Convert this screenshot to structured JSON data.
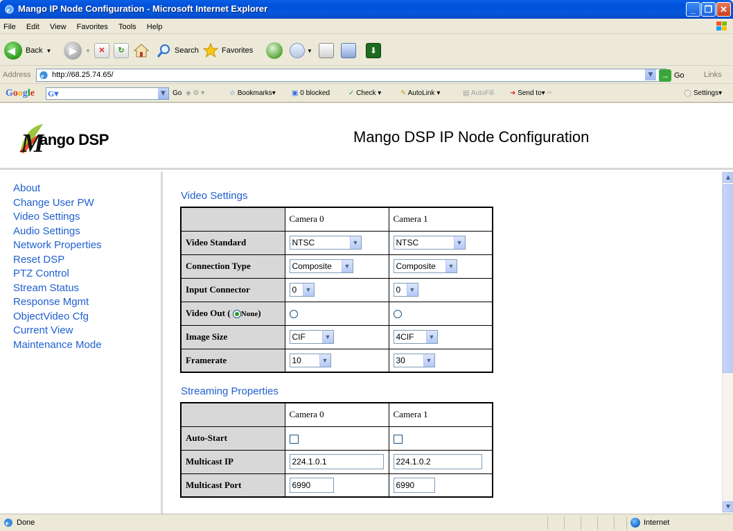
{
  "window": {
    "title": "Mango IP Node Configuration - Microsoft Internet Explorer"
  },
  "menu": [
    "File",
    "Edit",
    "View",
    "Favorites",
    "Tools",
    "Help"
  ],
  "toolbar": {
    "back_label": "Back",
    "search_label": "Search",
    "favorites_label": "Favorites"
  },
  "address": {
    "label": "Address",
    "url": "http://68.25.74.65/",
    "go_label": "Go",
    "links_label": "Links"
  },
  "google_bar": {
    "logo": "Google",
    "go_label": "Go",
    "bookmarks_label": "Bookmarks",
    "blocked_label": "0 blocked",
    "check_label": "Check",
    "autolink_label": "AutoLink",
    "autofill_label": "AutoFill",
    "sendto_label": "Send to",
    "settings_label": "Settings"
  },
  "header": {
    "logo_text": "ango DSP",
    "title": "Mango DSP IP Node Configuration"
  },
  "sidebar": {
    "items": [
      "About",
      "Change User PW",
      "Video Settings",
      "Audio Settings",
      "Network Properties",
      "Reset DSP",
      "PTZ Control",
      "Stream Status",
      "Response Mgmt",
      "ObjectVideo Cfg",
      "Current View",
      "Maintenance Mode"
    ]
  },
  "video_settings": {
    "title": "Video Settings",
    "columns": [
      "Camera 0",
      "Camera 1"
    ],
    "rows": {
      "video_standard": {
        "label": "Video Standard",
        "cam0": "NTSC",
        "cam1": "NTSC"
      },
      "connection_type": {
        "label": "Connection Type",
        "cam0": "Composite",
        "cam1": "Composite"
      },
      "input_connector": {
        "label": "Input Connector",
        "cam0": "0",
        "cam1": "0"
      },
      "video_out": {
        "label": "Video Out (",
        "none_label": "None",
        "close": ")"
      },
      "image_size": {
        "label": "Image Size",
        "cam0": "CIF",
        "cam1": "4CIF"
      },
      "framerate": {
        "label": "Framerate",
        "cam0": "10",
        "cam1": "30"
      }
    }
  },
  "streaming_properties": {
    "title": "Streaming Properties",
    "columns": [
      "Camera 0",
      "Camera 1"
    ],
    "rows": {
      "auto_start": {
        "label": "Auto-Start"
      },
      "multicast_ip": {
        "label": "Multicast IP",
        "cam0": "224.1.0.1",
        "cam1": "224.1.0.2"
      },
      "multicast_port": {
        "label": "Multicast Port",
        "cam0": "6990",
        "cam1": "6990"
      }
    }
  },
  "status": {
    "text": "Done",
    "zone": "Internet"
  },
  "colors": {
    "link": "#2060d0",
    "titlebar": "#0a5fe6",
    "table_header": "#d8d8d8"
  }
}
